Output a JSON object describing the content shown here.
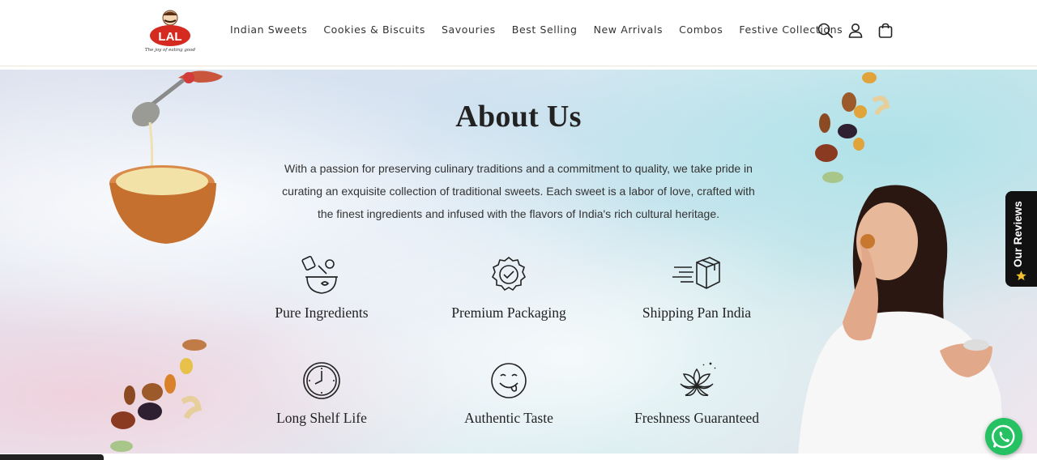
{
  "header": {
    "logo_text": "LAL",
    "logo_tagline": "The joy of eating good",
    "nav": [
      "Indian Sweets",
      "Cookies & Biscuits",
      "Savouries",
      "Best Selling",
      "New Arrivals",
      "Combos",
      "Festive Collections"
    ]
  },
  "about": {
    "title": "About Us",
    "description": "With a passion for preserving culinary traditions and a commitment to quality, we take pride in curating an exquisite collection of traditional sweets. Each sweet is a labor of love, crafted with the finest ingredients and infused with the flavors of India's rich cultural heritage.",
    "features": [
      {
        "label": "Pure Ingredients",
        "icon": "ingredients-icon"
      },
      {
        "label": "Premium Packaging",
        "icon": "quality-badge-icon"
      },
      {
        "label": "Shipping Pan India",
        "icon": "shipping-box-icon"
      },
      {
        "label": "Long Shelf Life",
        "icon": "clock-icon"
      },
      {
        "label": "Authentic Taste",
        "icon": "smiley-icon"
      },
      {
        "label": "Freshness Guaranteed",
        "icon": "flower-icon"
      }
    ]
  },
  "reviews_tab": {
    "label": "Our Reviews"
  },
  "colors": {
    "accent": "#d42a1f",
    "whatsapp": "#25c162",
    "reviews_bg": "#111111"
  }
}
